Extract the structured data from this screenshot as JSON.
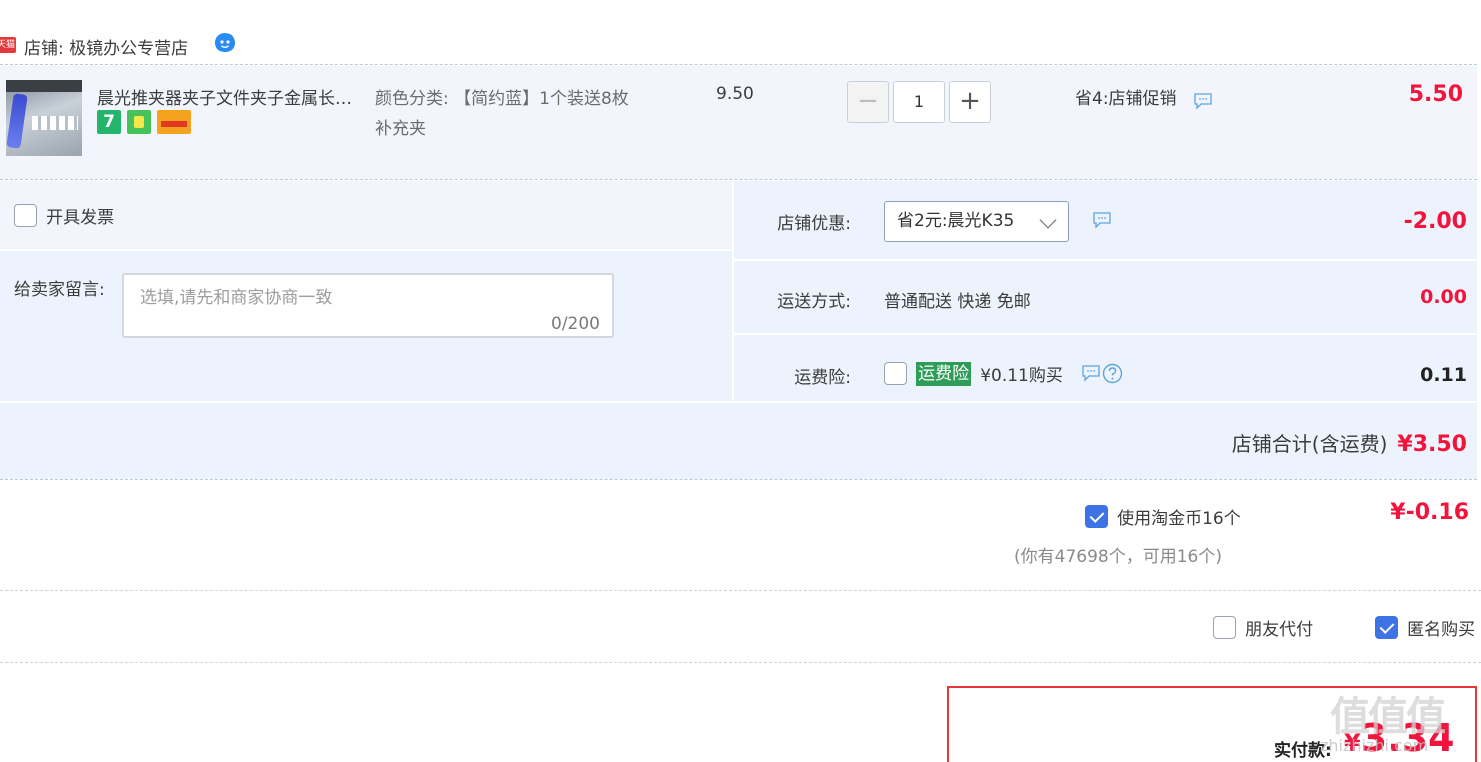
{
  "shop": {
    "badge": "天猫",
    "label": "店铺: 极镜办公专营店"
  },
  "item": {
    "title": "晨光推夹器夹子文件夹子金属长…",
    "sku": "颜色分类: 【简约蓝】1个装送8枚补充夹",
    "price": "9.50",
    "quantity": "1",
    "promo": "省4:店铺促销",
    "total": "5.50",
    "service_icons": [
      "seven-day-return-icon",
      "shopping-bag-icon",
      "credit-card-icon"
    ]
  },
  "invoice": {
    "label": "开具发票",
    "checked": false
  },
  "message": {
    "label": "给卖家留言:",
    "placeholder": "选填,请先和商家协商一致",
    "count": "0/200"
  },
  "coupon": {
    "label": "店铺优惠:",
    "selected": "省2元:晨光K35",
    "value": "-2.00"
  },
  "shipping": {
    "label": "运送方式:",
    "method": "普通配送 快递 免邮",
    "value": "0.00"
  },
  "insurance": {
    "label": "运费险:",
    "tag": "运费险",
    "text": "¥0.11购买",
    "value": "0.11",
    "checked": false
  },
  "subtotal": {
    "label": "店铺合计(含运费)",
    "amount": "¥3.50"
  },
  "coins": {
    "label": "使用淘金币16个",
    "hint": "(你有47698个，可用16个)",
    "amount": "¥-0.16",
    "checked": true
  },
  "options": {
    "friend_pay": {
      "label": "朋友代付",
      "checked": false
    },
    "anonymous": {
      "label": "匿名购买",
      "checked": true
    }
  },
  "final": {
    "label": "实付款:",
    "yen": "¥",
    "amount": "3.34"
  },
  "watermark": {
    "logo": "值值值",
    "site": "zhizhizhi.com"
  },
  "colors": {
    "price_red": "#f1143c",
    "checkbox_blue": "#3e73e6",
    "insure_green": "#2e9d57",
    "row_bg": "#f2f6fc"
  }
}
